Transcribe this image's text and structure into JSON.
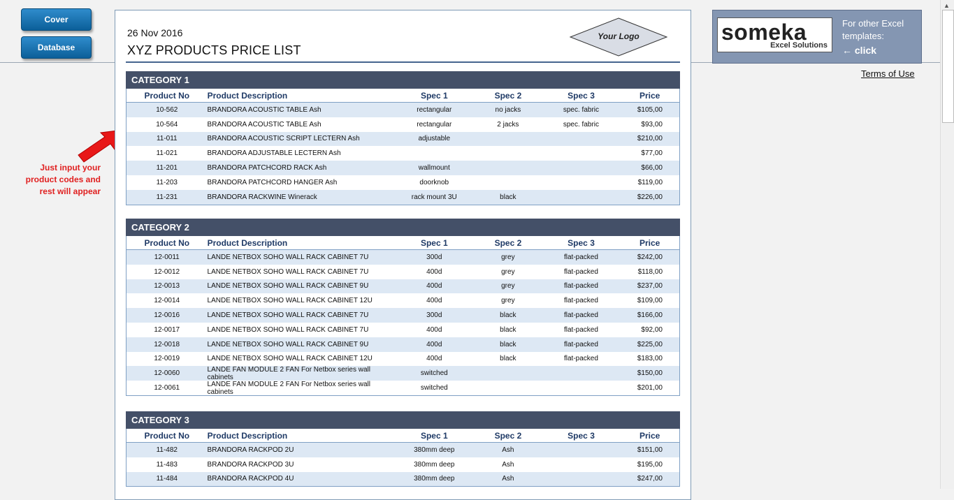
{
  "nav": {
    "cover": "Cover",
    "database": "Database"
  },
  "hint": {
    "line1": "Just input your",
    "line2": "product codes and",
    "line3": "rest will appear"
  },
  "sheet": {
    "date": "26 Nov 2016",
    "title": "XYZ PRODUCTS PRICE LIST",
    "logo": "Your Logo"
  },
  "columns": [
    "Product No",
    "Product Description",
    "Spec 1",
    "Spec 2",
    "Spec 3",
    "Price"
  ],
  "categories": [
    {
      "name": "CATEGORY 1",
      "rows": [
        [
          "10-562",
          "BRANDORA ACOUSTIC TABLE Ash",
          "rectangular",
          "no jacks",
          "spec. fabric",
          "$105,00"
        ],
        [
          "10-564",
          "BRANDORA ACOUSTIC TABLE Ash",
          "rectangular",
          "2 jacks",
          "spec. fabric",
          "$93,00"
        ],
        [
          "11-011",
          "BRANDORA ACOUSTIC SCRIPT LECTERN Ash",
          "adjustable",
          "",
          "",
          "$210,00"
        ],
        [
          "11-021",
          "BRANDORA ADJUSTABLE LECTERN Ash",
          "",
          "",
          "",
          "$77,00"
        ],
        [
          "11-201",
          "BRANDORA PATCHCORD RACK Ash",
          "wallmount",
          "",
          "",
          "$66,00"
        ],
        [
          "11-203",
          "BRANDORA PATCHCORD HANGER Ash",
          "doorknob",
          "",
          "",
          "$119,00"
        ],
        [
          "11-231",
          "BRANDORA RACKWINE Winerack",
          "rack mount 3U",
          "black",
          "",
          "$226,00"
        ]
      ]
    },
    {
      "name": "CATEGORY 2",
      "rows": [
        [
          "12-0011",
          "LANDE NETBOX SOHO WALL RACK CABINET 7U",
          "300d",
          "grey",
          "flat-packed",
          "$242,00"
        ],
        [
          "12-0012",
          "LANDE NETBOX SOHO WALL RACK CABINET 7U",
          "400d",
          "grey",
          "flat-packed",
          "$118,00"
        ],
        [
          "12-0013",
          "LANDE NETBOX SOHO WALL RACK CABINET 9U",
          "400d",
          "grey",
          "flat-packed",
          "$237,00"
        ],
        [
          "12-0014",
          "LANDE NETBOX SOHO WALL RACK CABINET 12U",
          "400d",
          "grey",
          "flat-packed",
          "$109,00"
        ],
        [
          "12-0016",
          "LANDE NETBOX SOHO WALL RACK CABINET 7U",
          "300d",
          "black",
          "flat-packed",
          "$166,00"
        ],
        [
          "12-0017",
          "LANDE NETBOX SOHO WALL RACK CABINET 7U",
          "400d",
          "black",
          "flat-packed",
          "$92,00"
        ],
        [
          "12-0018",
          "LANDE NETBOX SOHO WALL RACK CABINET 9U",
          "400d",
          "black",
          "flat-packed",
          "$225,00"
        ],
        [
          "12-0019",
          "LANDE NETBOX SOHO WALL RACK CABINET 12U",
          "400d",
          "black",
          "flat-packed",
          "$183,00"
        ],
        [
          "12-0060",
          "LANDE FAN MODULE 2 FAN For Netbox series wall cabinets",
          "switched",
          "",
          "",
          "$150,00"
        ],
        [
          "12-0061",
          "LANDE FAN MODULE 2 FAN For Netbox series wall cabinets",
          "switched",
          "",
          "",
          "$201,00"
        ]
      ]
    },
    {
      "name": "CATEGORY 3",
      "rows": [
        [
          "11-482",
          "BRANDORA RACKPOD 2U",
          "380mm deep",
          "Ash",
          "",
          "$151,00"
        ],
        [
          "11-483",
          "BRANDORA RACKPOD 3U",
          "380mm deep",
          "Ash",
          "",
          "$195,00"
        ],
        [
          "11-484",
          "BRANDORA RACKPOD 4U",
          "380mm deep",
          "Ash",
          "",
          "$247,00"
        ]
      ]
    }
  ],
  "someka": {
    "word": "someka",
    "sub": "Excel Solutions",
    "side1": "For other Excel",
    "side2": "templates:",
    "click": "← click"
  },
  "terms": "Terms of Use",
  "colors": {
    "header": "#445068",
    "shade": "#dde8f4",
    "accent": "#e02020"
  }
}
